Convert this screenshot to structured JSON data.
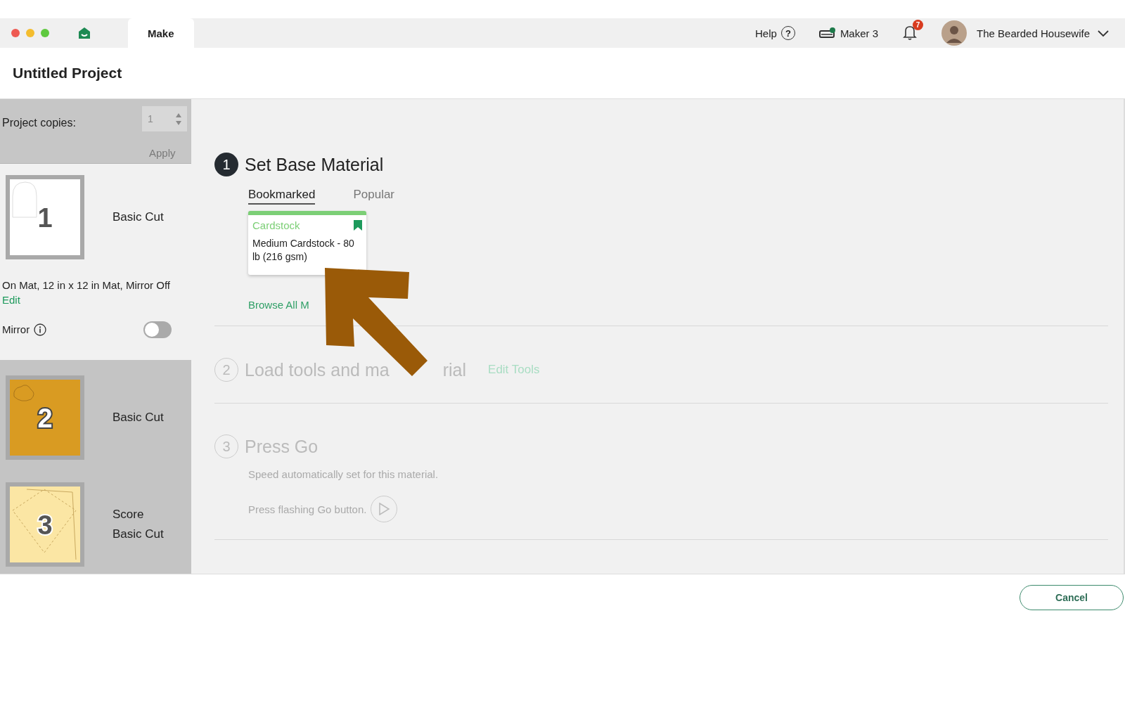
{
  "titlebar": {
    "tabs": [
      {
        "label": "Make",
        "selected": true
      }
    ],
    "help": "Help",
    "help_icon": "?",
    "machine": "Maker 3",
    "machine_connected": true,
    "notifications": "7",
    "user": "The Bearded Housewife"
  },
  "project": {
    "title": "Untitled Project"
  },
  "sidebar": {
    "copies_label": "Project copies:",
    "copies_value": "1",
    "copies_disabled": true,
    "apply": "Apply",
    "mats": [
      {
        "number": "1",
        "color": "#ffffff",
        "operations": [
          "Basic Cut"
        ],
        "selected": true,
        "details": "On Mat, 12 in x 12 in Mat, Mirror Off",
        "edit": "Edit",
        "mirror_label": "Mirror",
        "mirror_on": false
      },
      {
        "number": "2",
        "color": "#d99b22",
        "operations": [
          "Basic Cut"
        ],
        "selected": false
      },
      {
        "number": "3",
        "color": "#fbe6a4",
        "operations": [
          "Score",
          "Basic Cut"
        ],
        "selected": false
      }
    ]
  },
  "steps": [
    {
      "kind": "material",
      "number": "1",
      "title": "Set Base Material",
      "active": true,
      "tabs": [
        {
          "label": "Bookmarked",
          "selected": true
        },
        {
          "label": "Popular",
          "selected": false
        }
      ],
      "card": {
        "category": "Cardstock",
        "name": "Medium Cardstock - 80 lb (216 gsm)",
        "bookmarked": true
      },
      "browse": "Browse All M"
    },
    {
      "kind": "tools",
      "number": "2",
      "title": "Load tools and ma",
      "title_end": "rial",
      "active": false,
      "link": "Edit Tools"
    },
    {
      "kind": "go",
      "number": "3",
      "title": "Press Go",
      "active": false,
      "speed": "Speed automatically set for this material.",
      "press": "Press flashing Go button."
    }
  ],
  "footer": {
    "cancel": "Cancel"
  }
}
